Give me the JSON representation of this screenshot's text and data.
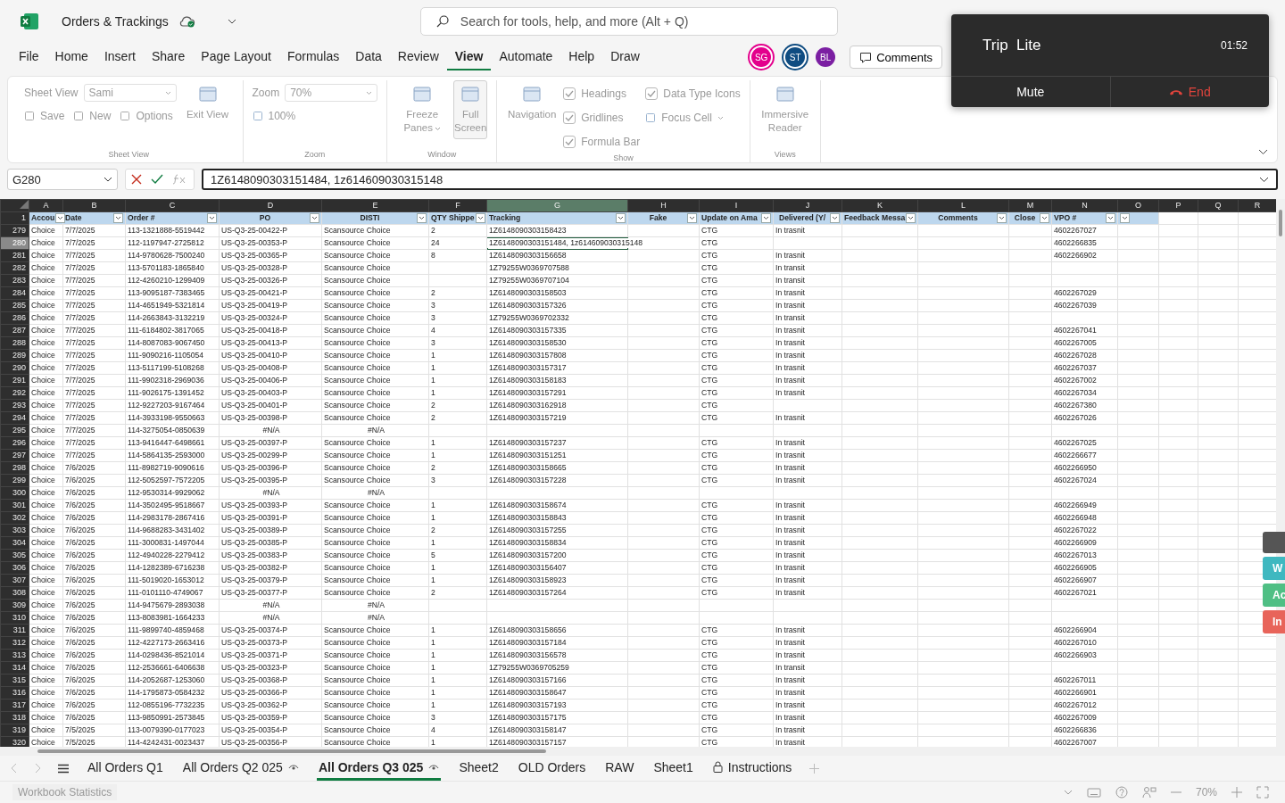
{
  "app": {
    "title": "Orders & Trackings",
    "search_placeholder": "Search for tools, help, and more (Alt + Q)"
  },
  "menu": [
    {
      "label": "File",
      "selected": false
    },
    {
      "label": "Home",
      "selected": false
    },
    {
      "label": "Insert",
      "selected": false
    },
    {
      "label": "Share",
      "selected": false
    },
    {
      "label": "Page Layout",
      "selected": false
    },
    {
      "label": "Formulas",
      "selected": false
    },
    {
      "label": "Data",
      "selected": false
    },
    {
      "label": "Review",
      "selected": false
    },
    {
      "label": "View",
      "selected": true
    },
    {
      "label": "Automate",
      "selected": false
    },
    {
      "label": "Help",
      "selected": false
    },
    {
      "label": "Draw",
      "selected": false
    }
  ],
  "collaborators": [
    {
      "initials": "SG",
      "color": "#e3008c"
    },
    {
      "initials": "ST",
      "color": "#0f4c81"
    },
    {
      "initials": "BL",
      "color": "#7b1fa2"
    }
  ],
  "comments_button": "Comments",
  "call": {
    "title": "Trip  Lite",
    "timer": "01:52",
    "mute": "Mute",
    "end": "End"
  },
  "ribbon": {
    "disabled": true,
    "groups": [
      {
        "label": "Sheet View",
        "parts": [
          {
            "kind": "stack",
            "items": [
              {
                "kind": "dropdown",
                "label": "Sheet View",
                "value": "Sami"
              },
              {
                "kind": "line",
                "items": [
                  {
                    "kind": "button",
                    "label": "Save"
                  },
                  {
                    "kind": "button",
                    "label": "New"
                  },
                  {
                    "kind": "button",
                    "label": "Options"
                  }
                ]
              }
            ]
          },
          {
            "kind": "large",
            "label": "Exit View",
            "pressed": false
          }
        ]
      },
      {
        "label": "Zoom",
        "parts": [
          {
            "kind": "stack",
            "items": [
              {
                "kind": "dropdown",
                "label": "Zoom",
                "value": "70%"
              },
              {
                "kind": "button",
                "label": "100%"
              }
            ]
          }
        ]
      },
      {
        "label": "Window",
        "parts": [
          {
            "kind": "large",
            "label": "Freeze Panes",
            "caret": true,
            "pressed": false
          },
          {
            "kind": "large",
            "label": "Full Screen",
            "pressed": true
          }
        ]
      },
      {
        "label": "Show",
        "parts": [
          {
            "kind": "large",
            "label": "Navigation",
            "pressed": false
          },
          {
            "kind": "stack",
            "items": [
              {
                "kind": "checkbox",
                "label": "Headings",
                "checked": true
              },
              {
                "kind": "checkbox",
                "label": "Gridlines",
                "checked": true
              },
              {
                "kind": "checkbox",
                "label": "Formula Bar",
                "checked": true
              }
            ]
          },
          {
            "kind": "stack",
            "items": [
              {
                "kind": "checkbox",
                "label": "Data Type Icons",
                "checked": true
              },
              {
                "kind": "button",
                "label": "Focus Cell",
                "caret": true
              }
            ]
          }
        ]
      },
      {
        "label": "Views",
        "parts": [
          {
            "kind": "large",
            "label": "Immersive Reader",
            "pressed": false
          }
        ]
      }
    ]
  },
  "formula_bar": {
    "name_box": "G280",
    "formula": "1Z6148090303151484, 1z614609030315148"
  },
  "sheet": {
    "columns": [
      {
        "letter": "A",
        "heading": "Accou",
        "filter": true,
        "selected": false
      },
      {
        "letter": "B",
        "heading": "Date",
        "filter": true,
        "selected": false
      },
      {
        "letter": "C",
        "heading": "Order #",
        "filter": true,
        "selected": false
      },
      {
        "letter": "D",
        "heading": "PO",
        "filter": true,
        "selected": false
      },
      {
        "letter": "E",
        "heading": "DISTI",
        "filter": true,
        "selected": false
      },
      {
        "letter": "F",
        "heading": "QTY Shippe",
        "filter": true,
        "selected": false
      },
      {
        "letter": "G",
        "heading": "Tracking",
        "filter": true,
        "selected": true
      },
      {
        "letter": "H",
        "heading": "Fake",
        "filter": true,
        "selected": false
      },
      {
        "letter": "I",
        "heading": "Update on Ama",
        "filter": true,
        "selected": false
      },
      {
        "letter": "J",
        "heading": "Delivered (Y/",
        "filter": true,
        "selected": false
      },
      {
        "letter": "K",
        "heading": "Feedback Messa",
        "filter": true,
        "selected": false
      },
      {
        "letter": "L",
        "heading": "Comments",
        "filter": true,
        "selected": false
      },
      {
        "letter": "M",
        "heading": "Close",
        "filter": true,
        "selected": false
      },
      {
        "letter": "N",
        "heading": "VPO #",
        "filter": true,
        "selected": false
      },
      {
        "letter": "O",
        "filter": true,
        "selected": false
      },
      {
        "letter": "P",
        "filter": false,
        "selected": false
      },
      {
        "letter": "Q",
        "filter": false,
        "selected": false
      },
      {
        "letter": "R",
        "filter": false,
        "selected": false
      }
    ],
    "header_row": "1",
    "rows": [
      {
        "num": "279",
        "selected": false,
        "cells": [
          "Choice",
          "7/7/2025",
          "113-1321888-5519442",
          "US-Q3-25-00422-P",
          "Scansource Choice",
          "2",
          "1Z6148090303158423",
          null,
          "CTG",
          "In trasnit",
          null,
          null,
          null,
          "4602267027"
        ]
      },
      {
        "num": "280",
        "selected": true,
        "cells": [
          "Choice",
          "7/7/2025",
          "112-1197947-2725812",
          "US-Q3-25-00353-P",
          "Scansource Choice",
          "24",
          "1Z6148090303151484, 1z614609030315148",
          null,
          "CTG",
          null,
          null,
          null,
          null,
          "4602266835"
        ]
      },
      {
        "num": "281",
        "selected": false,
        "cells": [
          "Choice",
          "7/7/2025",
          "114-9780628-7500240",
          "US-Q3-25-00365-P",
          "Scansource Choice",
          "8",
          "1Z6148090303156658",
          null,
          "CTG",
          "In trasnit",
          null,
          null,
          null,
          "4602266902"
        ]
      },
      {
        "num": "282",
        "selected": false,
        "cells": [
          "Choice",
          "7/7/2025",
          "113-5701183-1865840",
          "US-Q3-25-00328-P",
          "Scansource Choice",
          null,
          "1Z79255W0369707588",
          null,
          "CTG",
          "In transit",
          null,
          null,
          null,
          null
        ]
      },
      {
        "num": "283",
        "selected": false,
        "cells": [
          "Choice",
          "7/7/2025",
          "112-4260210-1299409",
          "US-Q3-25-00326-P",
          "Scansource Choice",
          null,
          "1Z79255W0369707104",
          null,
          "CTG",
          "In transit",
          null,
          null,
          null,
          null
        ]
      },
      {
        "num": "284",
        "selected": false,
        "cells": [
          "Choice",
          "7/7/2025",
          "113-9095187-7383465",
          "US-Q3-25-00421-P",
          "Scansource Choice",
          "2",
          "1Z6148090303158503",
          null,
          "CTG",
          "In trasnit",
          null,
          null,
          null,
          "4602267029"
        ]
      },
      {
        "num": "285",
        "selected": false,
        "cells": [
          "Choice",
          "7/7/2025",
          "114-4651949-5321814",
          "US-Q3-25-00419-P",
          "Scansource Choice",
          "3",
          "1Z6148090303157326",
          null,
          "CTG",
          "In trasnit",
          null,
          null,
          null,
          "4602267039"
        ]
      },
      {
        "num": "286",
        "selected": false,
        "cells": [
          "Choice",
          "7/7/2025",
          "114-2663843-3132219",
          "US-Q3-25-00324-P",
          "Scansource Choice",
          "3",
          "1Z79255W0369702332",
          null,
          "CTG",
          "In transit",
          null,
          null,
          null,
          null
        ]
      },
      {
        "num": "287",
        "selected": false,
        "cells": [
          "Choice",
          "7/7/2025",
          "111-6184802-3817065",
          "US-Q3-25-00418-P",
          "Scansource Choice",
          "4",
          "1Z6148090303157335",
          null,
          "CTG",
          "In trasnit",
          null,
          null,
          null,
          "4602267041"
        ]
      },
      {
        "num": "288",
        "selected": false,
        "cells": [
          "Choice",
          "7/7/2025",
          "114-8087083-9067450",
          "US-Q3-25-00413-P",
          "Scansource Choice",
          "3",
          "1Z6148090303158530",
          null,
          "CTG",
          "In trasnit",
          null,
          null,
          null,
          "4602267005"
        ]
      },
      {
        "num": "289",
        "selected": false,
        "cells": [
          "Choice",
          "7/7/2025",
          "111-9090216-1105054",
          "US-Q3-25-00410-P",
          "Scansource Choice",
          "1",
          "1Z6148090303157808",
          null,
          "CTG",
          "In trasnit",
          null,
          null,
          null,
          "4602267028"
        ]
      },
      {
        "num": "290",
        "selected": false,
        "cells": [
          "Choice",
          "7/7/2025",
          "113-5117199-5108268",
          "US-Q3-25-00408-P",
          "Scansource Choice",
          "1",
          "1Z6148090303157317",
          null,
          "CTG",
          "In trasnit",
          null,
          null,
          null,
          "4602267037"
        ]
      },
      {
        "num": "291",
        "selected": false,
        "cells": [
          "Choice",
          "7/7/2025",
          "111-9902318-2969036",
          "US-Q3-25-00406-P",
          "Scansource Choice",
          "1",
          "1Z6148090303158183",
          null,
          "CTG",
          "In trasnit",
          null,
          null,
          null,
          "4602267002"
        ]
      },
      {
        "num": "292",
        "selected": false,
        "cells": [
          "Choice",
          "7/7/2025",
          "111-9026175-1391452",
          "US-Q3-25-00403-P",
          "Scansource Choice",
          "1",
          "1Z6148090303157291",
          null,
          "CTG",
          "In trasnit",
          null,
          null,
          null,
          "4602267034"
        ]
      },
      {
        "num": "293",
        "selected": false,
        "cells": [
          "Choice",
          "7/7/2025",
          "112-9227203-9167464",
          "US-Q3-25-00401-P",
          "Scansource Choice",
          "2",
          "1Z6148090303162918",
          null,
          "CTG",
          null,
          null,
          null,
          null,
          "4602267380"
        ]
      },
      {
        "num": "294",
        "selected": false,
        "cells": [
          "Choice",
          "7/7/2025",
          "114-3933198-9550663",
          "US-Q3-25-00398-P",
          "Scansource Choice",
          "2",
          "1Z6148090303157219",
          null,
          "CTG",
          "In trasnit",
          null,
          null,
          null,
          "4602267026"
        ]
      },
      {
        "num": "295",
        "selected": false,
        "cells": [
          "Choice",
          "7/7/2025",
          "114-3275054-0850639",
          {
            "text": "#N/A",
            "kind": "error"
          },
          {
            "text": "#N/A",
            "kind": "error"
          },
          null,
          null,
          null,
          null,
          null,
          null,
          null,
          null,
          null
        ]
      },
      {
        "num": "296",
        "selected": false,
        "cells": [
          "Choice",
          "7/7/2025",
          "113-9416447-6498661",
          "US-Q3-25-00397-P",
          "Scansource Choice",
          "1",
          "1Z6148090303157237",
          null,
          "CTG",
          "In trasnit",
          null,
          null,
          null,
          "4602267025"
        ]
      },
      {
        "num": "297",
        "selected": false,
        "cells": [
          "Choice",
          "7/7/2025",
          "114-5864135-2593000",
          "US-Q3-25-00299-P",
          "Scansource Choice",
          "1",
          "1Z6148090303151251",
          null,
          "CTG",
          "In trasnit",
          null,
          null,
          null,
          "4602266677"
        ]
      },
      {
        "num": "298",
        "selected": false,
        "cells": [
          "Choice",
          "7/6/2025",
          "111-8982719-9090616",
          "US-Q3-25-00396-P",
          "Scansource Choice",
          "2",
          "1Z6148090303158665",
          null,
          "CTG",
          "In trasnit",
          null,
          null,
          null,
          "4602266950"
        ]
      },
      {
        "num": "299",
        "selected": false,
        "cells": [
          "Choice",
          "7/6/2025",
          "112-5052597-7572205",
          "US-Q3-25-00395-P",
          "Scansource Choice",
          "3",
          "1Z6148090303157228",
          null,
          "CTG",
          "In trasnit",
          null,
          null,
          null,
          "4602267024"
        ]
      },
      {
        "num": "300",
        "selected": false,
        "cells": [
          "Choice",
          "7/6/2025",
          "112-9530314-9929062",
          {
            "text": "#N/A",
            "kind": "error"
          },
          {
            "text": "#N/A",
            "kind": "error"
          },
          null,
          null,
          null,
          null,
          null,
          null,
          null,
          null,
          null
        ]
      },
      {
        "num": "301",
        "selected": false,
        "cells": [
          "Choice",
          "7/6/2025",
          "114-3502495-9518667",
          "US-Q3-25-00393-P",
          "Scansource Choice",
          "1",
          "1Z6148090303158674",
          null,
          "CTG",
          "In trasnit",
          null,
          null,
          null,
          "4602266949"
        ]
      },
      {
        "num": "302",
        "selected": false,
        "cells": [
          "Choice",
          "7/6/2025",
          "114-2983178-2867416",
          "US-Q3-25-00391-P",
          "Scansource Choice",
          "1",
          "1Z6148090303158843",
          null,
          "CTG",
          "In trasnit",
          null,
          null,
          null,
          "4602266948"
        ]
      },
      {
        "num": "303",
        "selected": false,
        "cells": [
          "Choice",
          "7/6/2025",
          "114-9688283-3431402",
          "US-Q3-25-00389-P",
          "Scansource Choice",
          "2",
          "1Z6148090303157255",
          null,
          "CTG",
          "In trasnit",
          null,
          null,
          null,
          "4602267022"
        ]
      },
      {
        "num": "304",
        "selected": false,
        "cells": [
          "Choice",
          "7/6/2025",
          "111-3000831-1497044",
          "US-Q3-25-00385-P",
          "Scansource Choice",
          "1",
          "1Z6148090303158834",
          null,
          "CTG",
          "In trasnit",
          null,
          null,
          null,
          "4602266909"
        ]
      },
      {
        "num": "305",
        "selected": false,
        "cells": [
          "Choice",
          "7/6/2025",
          "112-4940228-2279412",
          "US-Q3-25-00383-P",
          "Scansource Choice",
          "5",
          "1Z6148090303157200",
          null,
          "CTG",
          "In trasnit",
          null,
          null,
          null,
          "4602267013"
        ]
      },
      {
        "num": "306",
        "selected": false,
        "cells": [
          "Choice",
          "7/6/2025",
          "114-1282389-6716238",
          "US-Q3-25-00382-P",
          "Scansource Choice",
          "1",
          "1Z6148090303156407",
          null,
          "CTG",
          "In trasnit",
          null,
          null,
          null,
          "4602266905"
        ]
      },
      {
        "num": "307",
        "selected": false,
        "cells": [
          "Choice",
          "7/6/2025",
          "111-5019020-1653012",
          "US-Q3-25-00379-P",
          "Scansource Choice",
          "1",
          "1Z6148090303158923",
          null,
          "CTG",
          "In trasnit",
          null,
          null,
          null,
          "4602266907"
        ]
      },
      {
        "num": "308",
        "selected": false,
        "cells": [
          "Choice",
          "7/6/2025",
          "111-0101110-4749067",
          "US-Q3-25-00377-P",
          "Scansource Choice",
          "2",
          "1Z6148090303157264",
          null,
          "CTG",
          "In trasnit",
          null,
          null,
          null,
          "4602267021"
        ]
      },
      {
        "num": "309",
        "selected": false,
        "cells": [
          "Choice",
          "7/6/2025",
          "114-9475679-2893038",
          {
            "text": "#N/A",
            "kind": "error"
          },
          {
            "text": "#N/A",
            "kind": "error"
          },
          null,
          null,
          null,
          null,
          null,
          null,
          null,
          null,
          null
        ]
      },
      {
        "num": "310",
        "selected": false,
        "cells": [
          "Choice",
          "7/6/2025",
          "113-8083981-1664233",
          {
            "text": "#N/A",
            "kind": "error"
          },
          {
            "text": "#N/A",
            "kind": "error"
          },
          null,
          null,
          null,
          null,
          null,
          null,
          null,
          null,
          null
        ]
      },
      {
        "num": "311",
        "selected": false,
        "cells": [
          "Choice",
          "7/6/2025",
          "111-9899740-4859468",
          "US-Q3-25-00374-P",
          "Scansource Choice",
          "1",
          "1Z6148090303158656",
          null,
          "CTG",
          "In trasnit",
          null,
          null,
          null,
          "4602266904"
        ]
      },
      {
        "num": "312",
        "selected": false,
        "cells": [
          "Choice",
          "7/6/2025",
          "112-4227173-2663416",
          "US-Q3-25-00373-P",
          "Scansource Choice",
          "1",
          "1Z6148090303157184",
          null,
          "CTG",
          "In trasnit",
          null,
          null,
          null,
          "4602267010"
        ]
      },
      {
        "num": "313",
        "selected": false,
        "cells": [
          "Choice",
          "7/6/2025",
          "114-0298436-8521014",
          "US-Q3-25-00371-P",
          "Scansource Choice",
          "1",
          "1Z6148090303156578",
          null,
          "CTG",
          "In trasnit",
          null,
          null,
          null,
          "4602266903"
        ]
      },
      {
        "num": "314",
        "selected": false,
        "cells": [
          "Choice",
          "7/6/2025",
          "112-2536661-6406638",
          "US-Q3-25-00323-P",
          "Scansource Choice",
          "1",
          "1Z79255W0369705259",
          null,
          "CTG",
          "In transit",
          null,
          null,
          null,
          null
        ]
      },
      {
        "num": "315",
        "selected": false,
        "cells": [
          "Choice",
          "7/6/2025",
          "114-2052687-1253060",
          "US-Q3-25-00368-P",
          "Scansource Choice",
          "1",
          "1Z6148090303157166",
          null,
          "CTG",
          "In trasnit",
          null,
          null,
          null,
          "4602267011"
        ]
      },
      {
        "num": "316",
        "selected": false,
        "cells": [
          "Choice",
          "7/6/2025",
          "114-1795873-0584232",
          "US-Q3-25-00366-P",
          "Scansource Choice",
          "1",
          "1Z6148090303158647",
          null,
          "CTG",
          "In trasnit",
          null,
          null,
          null,
          "4602266901"
        ]
      },
      {
        "num": "317",
        "selected": false,
        "cells": [
          "Choice",
          "7/6/2025",
          "112-0855196-7732235",
          "US-Q3-25-00362-P",
          "Scansource Choice",
          "1",
          "1Z6148090303157193",
          null,
          "CTG",
          "In trasnit",
          null,
          null,
          null,
          "4602267012"
        ]
      },
      {
        "num": "318",
        "selected": false,
        "cells": [
          "Choice",
          "7/6/2025",
          "113-9850991-2573845",
          "US-Q3-25-00359-P",
          "Scansource Choice",
          "3",
          "1Z6148090303157175",
          null,
          "CTG",
          "In trasnit",
          null,
          null,
          null,
          "4602267009"
        ]
      },
      {
        "num": "319",
        "selected": false,
        "cells": [
          "Choice",
          "7/5/2025",
          "113-0079390-0177023",
          "US-Q3-25-00354-P",
          "Scansource Choice",
          "4",
          "1Z6148090303158147",
          null,
          "CTG",
          "In trasnit",
          null,
          null,
          null,
          "4602266836"
        ]
      },
      {
        "num": "320",
        "selected": false,
        "cells": [
          "Choice",
          "7/5/2025",
          "114-4242431-0023437",
          "US-Q3-25-00356-P",
          "Scansource Choice",
          "1",
          "1Z6148090303157157",
          null,
          "CTG",
          "In trasnit",
          null,
          null,
          null,
          "4602267007"
        ]
      }
    ]
  },
  "sheet_tabs": [
    {
      "label": "All Orders Q1",
      "kind": "plain",
      "selected": false
    },
    {
      "label": "All Orders Q2 025",
      "kind": "watched",
      "selected": false
    },
    {
      "label": "All Orders Q3 025",
      "kind": "watched",
      "selected": true
    },
    {
      "label": "Sheet2",
      "kind": "plain",
      "selected": false
    },
    {
      "label": "OLD Orders",
      "kind": "plain",
      "selected": false
    },
    {
      "label": "RAW",
      "kind": "plain",
      "selected": false
    },
    {
      "label": "Sheet1",
      "kind": "plain",
      "selected": false
    },
    {
      "label": "Instructions",
      "kind": "locked",
      "selected": false
    }
  ],
  "side_tabs": [
    {
      "label": "W",
      "color": "#3fb8c0"
    },
    {
      "label": "Ac",
      "color": "#4fbf84"
    },
    {
      "label": "In",
      "color": "#e8645a"
    }
  ],
  "status_bar": {
    "left": "Workbook Statistics",
    "zoom": "70%"
  }
}
